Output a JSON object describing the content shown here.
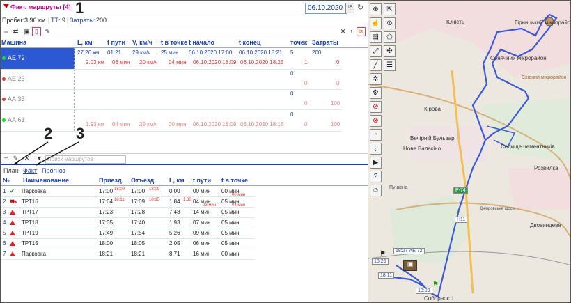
{
  "header": {
    "title": "Факт. маршруты [4]",
    "date": "06.10.2020",
    "calendar_label": "15"
  },
  "stats": {
    "mileage_label": "Пробег:",
    "mileage_value": "3.96 км",
    "tt_label": "ТТ:",
    "tt_value": "9",
    "cost_label": "Затраты:",
    "cost_value": "200"
  },
  "routes_table": {
    "headers": [
      "Машина",
      "L, км",
      "t пути",
      "V, км/ч",
      "t в точке",
      "t начало",
      "t конец",
      "точек",
      "Затраты"
    ],
    "vehicles": [
      {
        "name": "АЕ 72",
        "dot": "#22aa22",
        "selected": true,
        "plan": [
          "27.26 км",
          "01:21",
          "29 км/ч",
          "25 мин",
          "06.10.2020 17:00",
          "06.10.2020 18:21",
          "5",
          "200"
        ],
        "fact": [
          "2.03 км",
          "06 мин",
          "20 км/ч",
          "04 мин",
          "06.10.2020 18:09",
          "06.10.2020 18:25",
          "1",
          "0"
        ]
      },
      {
        "name": "АЕ 23",
        "dot": "#e33",
        "selected": false,
        "plan": [
          "",
          "",
          "",
          "",
          "",
          "",
          "0",
          ""
        ],
        "fact": [
          "",
          "",
          "",
          "",
          "",
          "",
          "0",
          "0"
        ]
      },
      {
        "name": "АА 35",
        "dot": "#e33",
        "selected": false,
        "plan": [
          "",
          "",
          "",
          "",
          "",
          "",
          "0",
          ""
        ],
        "fact": [
          "",
          "",
          "",
          "",
          "",
          "",
          "0",
          "100"
        ]
      },
      {
        "name": "АА 61",
        "dot": "#22aa22",
        "selected": false,
        "plan": [
          "",
          "",
          "",
          "",
          "",
          "",
          "0",
          ""
        ],
        "fact": [
          "1.93 км",
          "04 мин",
          "29 км/ч",
          "00 мин",
          "06.10.2020 18:09",
          "06.10.2020 18:18",
          "0",
          "100"
        ]
      }
    ]
  },
  "search": {
    "placeholder": "Поиск маршрутов"
  },
  "tabs": [
    {
      "label": "План"
    },
    {
      "label": "Факт"
    },
    {
      "label": "Прогноз"
    }
  ],
  "points_table": {
    "headers": [
      "№",
      "Наименование",
      "Приезд",
      "Отъезд",
      "L, км",
      "t пути",
      "t в точке"
    ],
    "rows": [
      {
        "n": "1",
        "status": "check",
        "name": "Парковка",
        "arr": "17:00",
        "arr_f": "18:09",
        "dep": "17:00",
        "dep_f": "18:09",
        "l": "0.00",
        "l_f": "",
        "t": "00 мин",
        "t_f": "",
        "tp": "00 мин",
        "tp_f": "00 мин"
      },
      {
        "n": "2",
        "status": "car",
        "name": "ТРТ16",
        "arr": "17:04",
        "arr_f": "18:11",
        "dep": "17:09",
        "dep_f": "18:15",
        "l": "1.84",
        "l_f": "1.30",
        "t": "04 мин",
        "t_f": "03 мин",
        "tp": "05 мин",
        "tp_f": "04 мин"
      },
      {
        "n": "3",
        "status": "warn",
        "name": "ТРТ17",
        "arr": "17:23",
        "arr_f": "",
        "dep": "17:28",
        "dep_f": "",
        "l": "7.48",
        "l_f": "",
        "t": "14 мин",
        "t_f": "",
        "tp": "05 мин",
        "tp_f": ""
      },
      {
        "n": "4",
        "status": "warn",
        "name": "ТРТ18",
        "arr": "17:35",
        "arr_f": "",
        "dep": "17:40",
        "dep_f": "",
        "l": "1.93",
        "l_f": "",
        "t": "07 мин",
        "t_f": "",
        "tp": "05 мин",
        "tp_f": ""
      },
      {
        "n": "5",
        "status": "warn",
        "name": "ТРТ19",
        "arr": "17:49",
        "arr_f": "",
        "dep": "17:54",
        "dep_f": "",
        "l": "5.26",
        "l_f": "",
        "t": "09 мин",
        "t_f": "",
        "tp": "05 мин",
        "tp_f": ""
      },
      {
        "n": "6",
        "status": "warn",
        "name": "ТРТ15",
        "arr": "18:00",
        "arr_f": "",
        "dep": "18:05",
        "dep_f": "",
        "l": "2.05",
        "l_f": "",
        "t": "06 мин",
        "t_f": "",
        "tp": "05 мин",
        "tp_f": ""
      },
      {
        "n": "7",
        "status": "warn",
        "name": "Парковка",
        "arr": "18:21",
        "arr_f": "",
        "dep": "18:21",
        "dep_f": "",
        "l": "8.71",
        "l_f": "",
        "t": "16 мин",
        "t_f": "",
        "tp": "00 мин",
        "tp_f": ""
      }
    ]
  },
  "annotations": [
    "1",
    "2",
    "3"
  ],
  "map": {
    "labels": [
      "Юність",
      "Гірницький мікрорайон",
      "Сонячний мікрорайон",
      "Східний мікрорайон",
      "Кірова",
      "Вечірній Бульвар",
      "Нове Балакіно",
      "Селище цементників",
      "Розвилка",
      "Двовинцеве",
      "Пушкіна",
      "Дніпровське шосе",
      "Соборності"
    ],
    "bubbles": [
      {
        "label": "18:27 АЕ 72"
      },
      {
        "label": "18:25"
      },
      {
        "label": "18:11"
      },
      {
        "label": "18:09"
      },
      {
        "label": "H11"
      },
      {
        "label": "P-74"
      }
    ],
    "tool_icons": [
      "crosshair-icon",
      "cursor-select-icon",
      "hand-icon",
      "pin-icon",
      "route-arrows-icon",
      "polygon-icon",
      "measure-icon",
      "wand-icon",
      "ruler-icon",
      "list-icon",
      "gear-icon",
      "car-icon",
      "warning-icon",
      "stop-icon",
      "pacman-icon",
      "traffic-light-icon",
      "film-icon",
      "help-icon",
      "dog-icon"
    ]
  }
}
